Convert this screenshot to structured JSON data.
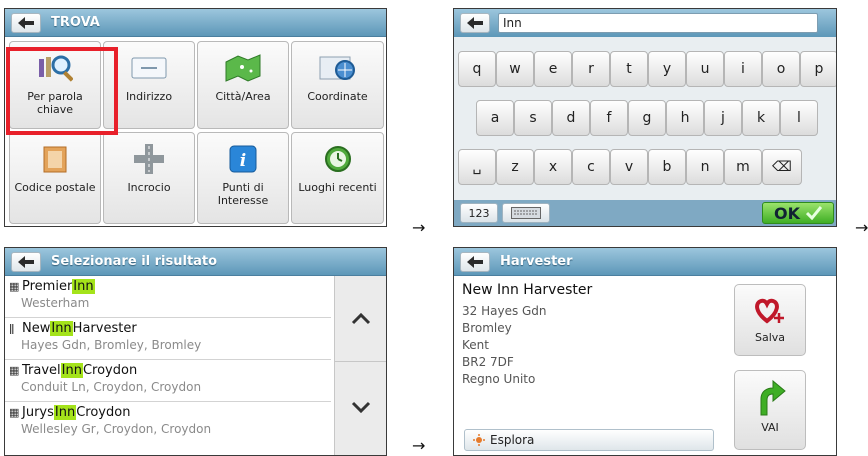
{
  "arrow_glyph": "→",
  "panel1": {
    "title": "TROVA",
    "items": [
      {
        "label": "Per parola chiave",
        "icon": "keyword-search-icon"
      },
      {
        "label": "Indirizzo",
        "icon": "address-icon"
      },
      {
        "label": "Città/Area",
        "icon": "city-area-map-icon"
      },
      {
        "label": "Coordinate",
        "icon": "coordinates-icon"
      },
      {
        "label": "Codice postale",
        "icon": "postcode-icon"
      },
      {
        "label": "Incrocio",
        "icon": "intersection-icon"
      },
      {
        "label": "Punti di Interesse",
        "icon": "info-icon"
      },
      {
        "label": "Luoghi recenti",
        "icon": "recent-places-clock-icon"
      }
    ]
  },
  "panel2": {
    "input_value": "Inn",
    "rows": [
      [
        "q",
        "w",
        "e",
        "r",
        "t",
        "y",
        "u",
        "i",
        "o",
        "p"
      ],
      [
        "a",
        "s",
        "d",
        "f",
        "g",
        "h",
        "j",
        "k",
        "l"
      ],
      [
        "␣",
        "z",
        "x",
        "c",
        "v",
        "b",
        "n",
        "m",
        "⌫"
      ]
    ],
    "mode_label": "123",
    "ok_label": "OK"
  },
  "panel3": {
    "title": "Selezionare il risultato",
    "results": [
      {
        "pre": "Premier ",
        "match": "Inn",
        "post": "",
        "address": "Westerham",
        "icon": "▦"
      },
      {
        "pre": "New ",
        "match": "Inn",
        "post": " Harvester",
        "address": "Hayes Gdn, Bromley, Bromley",
        "icon": "ǁ"
      },
      {
        "pre": "Travel ",
        "match": "Inn",
        "post": " Croydon",
        "address": "Conduit Ln, Croydon, Croydon",
        "icon": "▦"
      },
      {
        "pre": "Jurys ",
        "match": "Inn",
        "post": " Croydon",
        "address": "Wellesley Gr, Croydon, Croydon",
        "icon": "▦"
      }
    ]
  },
  "panel4": {
    "title": "Harvester",
    "name": "New Inn Harvester",
    "lines": [
      "32 Hayes Gdn",
      "Bromley",
      "Kent",
      "BR2 7DF",
      "Regno Unito"
    ],
    "save_label": "Salva",
    "go_label": "VAI",
    "explore_label": "Esplora"
  }
}
